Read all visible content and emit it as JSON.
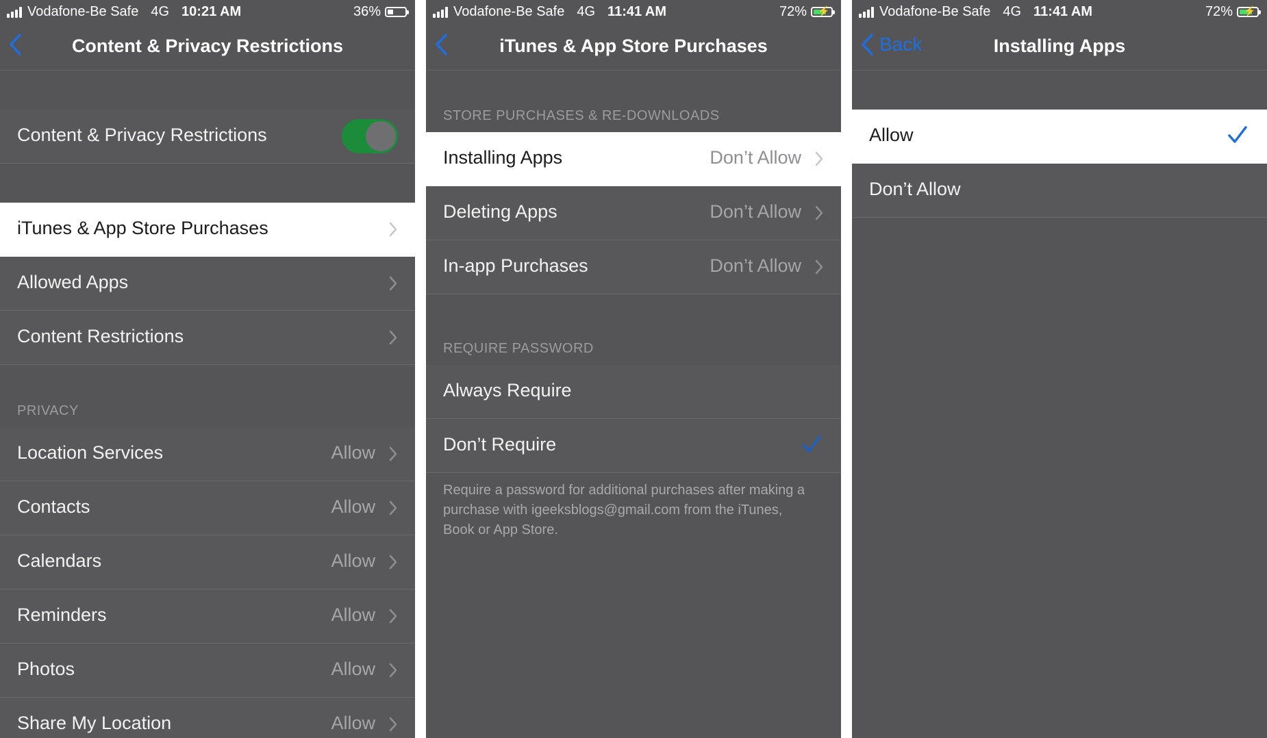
{
  "panels": [
    {
      "status": {
        "carrier": "Vodafone-Be Safe",
        "network": "4G",
        "time": "10:21 AM",
        "battery": "36%",
        "battery_level": 0.36
      },
      "nav": {
        "title": "Content & Privacy Restrictions"
      },
      "toggle_row": {
        "label": "Content & Privacy Restrictions",
        "on": true
      },
      "rows": [
        {
          "label": "iTunes & App Store Purchases"
        },
        {
          "label": "Allowed Apps"
        },
        {
          "label": "Content Restrictions"
        }
      ],
      "privacy_header": "PRIVACY",
      "privacy_rows": [
        {
          "label": "Location Services",
          "value": "Allow"
        },
        {
          "label": "Contacts",
          "value": "Allow"
        },
        {
          "label": "Calendars",
          "value": "Allow"
        },
        {
          "label": "Reminders",
          "value": "Allow"
        },
        {
          "label": "Photos",
          "value": "Allow"
        },
        {
          "label": "Share My Location",
          "value": "Allow"
        }
      ]
    },
    {
      "status": {
        "carrier": "Vodafone-Be Safe",
        "network": "4G",
        "time": "11:41 AM",
        "battery": "72%",
        "battery_level": 0.72
      },
      "nav": {
        "title": "iTunes & App Store Purchases"
      },
      "store_header": "STORE PURCHASES & RE-DOWNLOADS",
      "store_rows": [
        {
          "label": "Installing Apps",
          "value": "Don’t Allow"
        },
        {
          "label": "Deleting Apps",
          "value": "Don’t Allow"
        },
        {
          "label": "In-app Purchases",
          "value": "Don’t Allow"
        }
      ],
      "password_header": "REQUIRE PASSWORD",
      "password_rows": [
        {
          "label": "Always Require"
        },
        {
          "label": "Don’t Require",
          "checked": true
        }
      ],
      "footer": "Require a password for additional purchases after making a purchase with igeeksblogs@gmail.com from the iTunes, Book or App Store."
    },
    {
      "status": {
        "carrier": "Vodafone-Be Safe",
        "network": "4G",
        "time": "11:41 AM",
        "battery": "72%",
        "battery_level": 0.72
      },
      "nav": {
        "title": "Installing Apps",
        "back": "Back"
      },
      "options": [
        {
          "label": "Allow",
          "checked": true
        },
        {
          "label": "Don’t Allow"
        }
      ]
    }
  ],
  "colors": {
    "accent": "#1d6fe0",
    "toggle_on": "#1a8c3a",
    "battery_charging": "#4cd964"
  }
}
